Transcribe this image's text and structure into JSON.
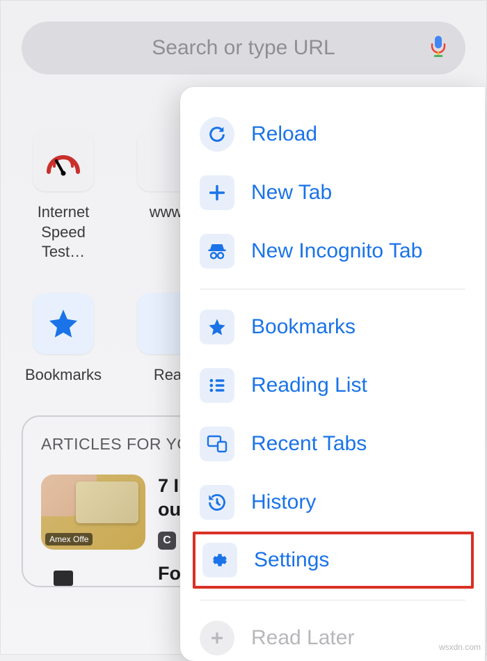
{
  "search": {
    "placeholder": "Search or type URL"
  },
  "shortcuts": {
    "row1": [
      {
        "label": "Internet\nSpeed Test…"
      },
      {
        "label": "www."
      }
    ],
    "row2": [
      {
        "label": "Bookmarks"
      },
      {
        "label": "Rea"
      }
    ]
  },
  "articles": {
    "heading": "ARTICLES FOR YO",
    "items": [
      {
        "headline_top": "7 I",
        "headline_bottom": "ou",
        "badge": "Amex Offe",
        "chip": "C"
      },
      {
        "headline_top": "Fo"
      }
    ]
  },
  "menu": {
    "reload": "Reload",
    "new_tab": "New Tab",
    "incognito": "New Incognito Tab",
    "bookmarks": "Bookmarks",
    "reading_list": "Reading List",
    "recent_tabs": "Recent Tabs",
    "history": "History",
    "settings": "Settings",
    "read_later": "Read Later"
  },
  "watermark": "wsxdn.com"
}
